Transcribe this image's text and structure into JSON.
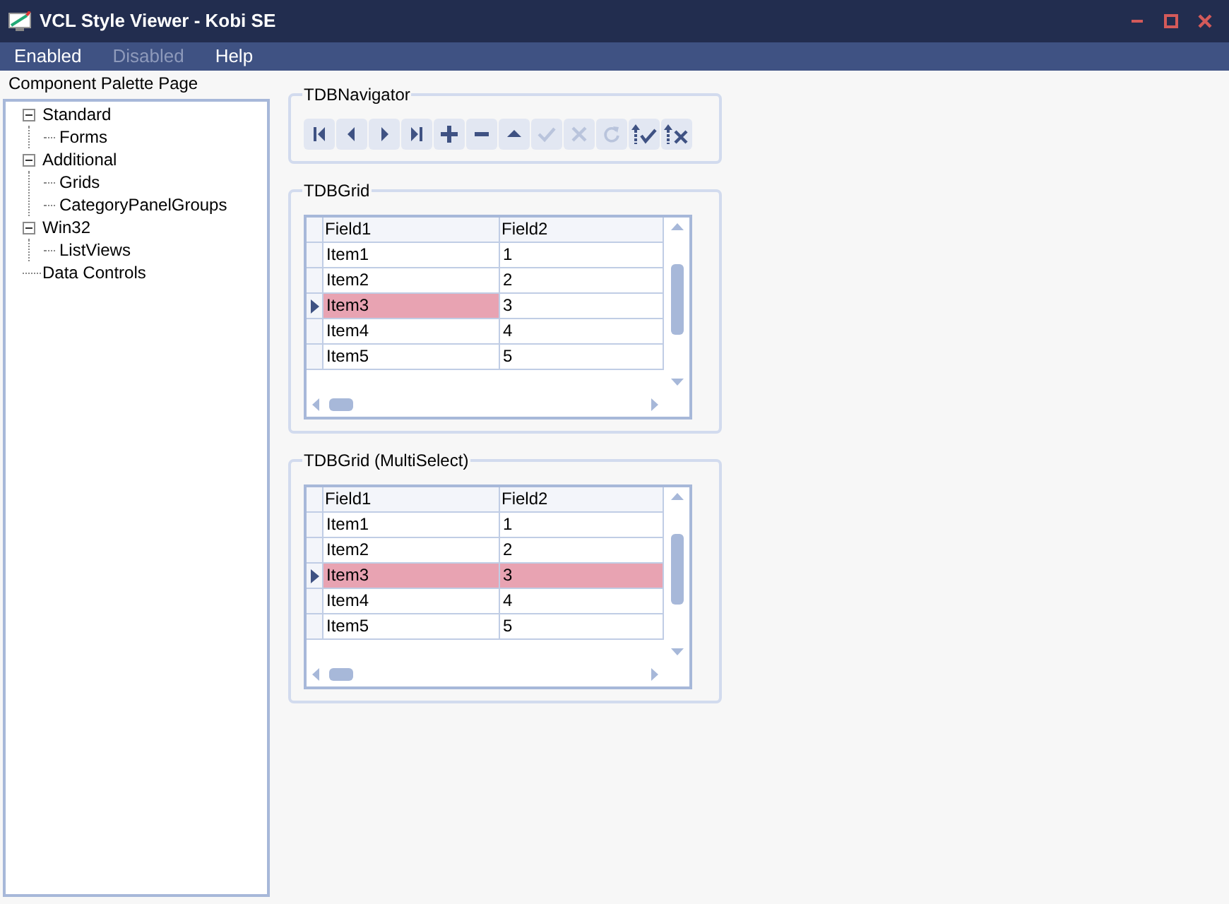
{
  "window": {
    "title": "VCL Style Viewer - Kobi SE"
  },
  "menu": [
    {
      "label": "Enabled",
      "disabled": false
    },
    {
      "label": "Disabled",
      "disabled": true
    },
    {
      "label": "Help",
      "disabled": false
    }
  ],
  "sidebar": {
    "title": "Component Palette Page",
    "tree": [
      {
        "label": "Standard",
        "expanded": true,
        "children": [
          {
            "label": "Forms"
          }
        ]
      },
      {
        "label": "Additional",
        "expanded": true,
        "children": [
          {
            "label": "Grids"
          },
          {
            "label": "CategoryPanelGroups"
          }
        ]
      },
      {
        "label": "Win32",
        "expanded": true,
        "children": [
          {
            "label": "ListViews"
          }
        ]
      },
      {
        "label": "Data Controls"
      }
    ]
  },
  "navigator": {
    "title": "TDBNavigator",
    "buttons": [
      {
        "kind": "first",
        "disabled": false
      },
      {
        "kind": "prior",
        "disabled": false
      },
      {
        "kind": "next",
        "disabled": false
      },
      {
        "kind": "last",
        "disabled": false
      },
      {
        "kind": "insert",
        "disabled": false
      },
      {
        "kind": "delete",
        "disabled": false
      },
      {
        "kind": "edit",
        "disabled": false
      },
      {
        "kind": "post",
        "disabled": true
      },
      {
        "kind": "cancel",
        "disabled": true
      },
      {
        "kind": "refresh",
        "disabled": true
      },
      {
        "kind": "apply",
        "disabled": false
      },
      {
        "kind": "discard",
        "disabled": false
      }
    ]
  },
  "grids": [
    {
      "title": "TDBGrid",
      "columns": [
        "Field1",
        "Field2"
      ],
      "rows": [
        {
          "current": false,
          "cells": [
            {
              "text": "Item1",
              "selected": false
            },
            {
              "text": "1",
              "selected": false
            }
          ]
        },
        {
          "current": false,
          "cells": [
            {
              "text": "Item2",
              "selected": false
            },
            {
              "text": "2",
              "selected": false
            }
          ]
        },
        {
          "current": true,
          "cells": [
            {
              "text": "Item3",
              "selected": true
            },
            {
              "text": "3",
              "selected": false
            }
          ]
        },
        {
          "current": false,
          "cells": [
            {
              "text": "Item4",
              "selected": false
            },
            {
              "text": "4",
              "selected": false
            }
          ]
        },
        {
          "current": false,
          "cells": [
            {
              "text": "Item5",
              "selected": false
            },
            {
              "text": "5",
              "selected": false
            }
          ]
        }
      ]
    },
    {
      "title": "TDBGrid (MultiSelect)",
      "columns": [
        "Field1",
        "Field2"
      ],
      "rows": [
        {
          "current": false,
          "cells": [
            {
              "text": "Item1",
              "selected": false
            },
            {
              "text": "1",
              "selected": false
            }
          ]
        },
        {
          "current": false,
          "cells": [
            {
              "text": "Item2",
              "selected": false
            },
            {
              "text": "2",
              "selected": false
            }
          ]
        },
        {
          "current": true,
          "cells": [
            {
              "text": "Item3",
              "selected": true
            },
            {
              "text": "3",
              "selected": true
            }
          ]
        },
        {
          "current": false,
          "cells": [
            {
              "text": "Item4",
              "selected": false
            },
            {
              "text": "4",
              "selected": false
            }
          ]
        },
        {
          "current": false,
          "cells": [
            {
              "text": "Item5",
              "selected": false
            },
            {
              "text": "5",
              "selected": false
            }
          ]
        }
      ]
    }
  ]
}
